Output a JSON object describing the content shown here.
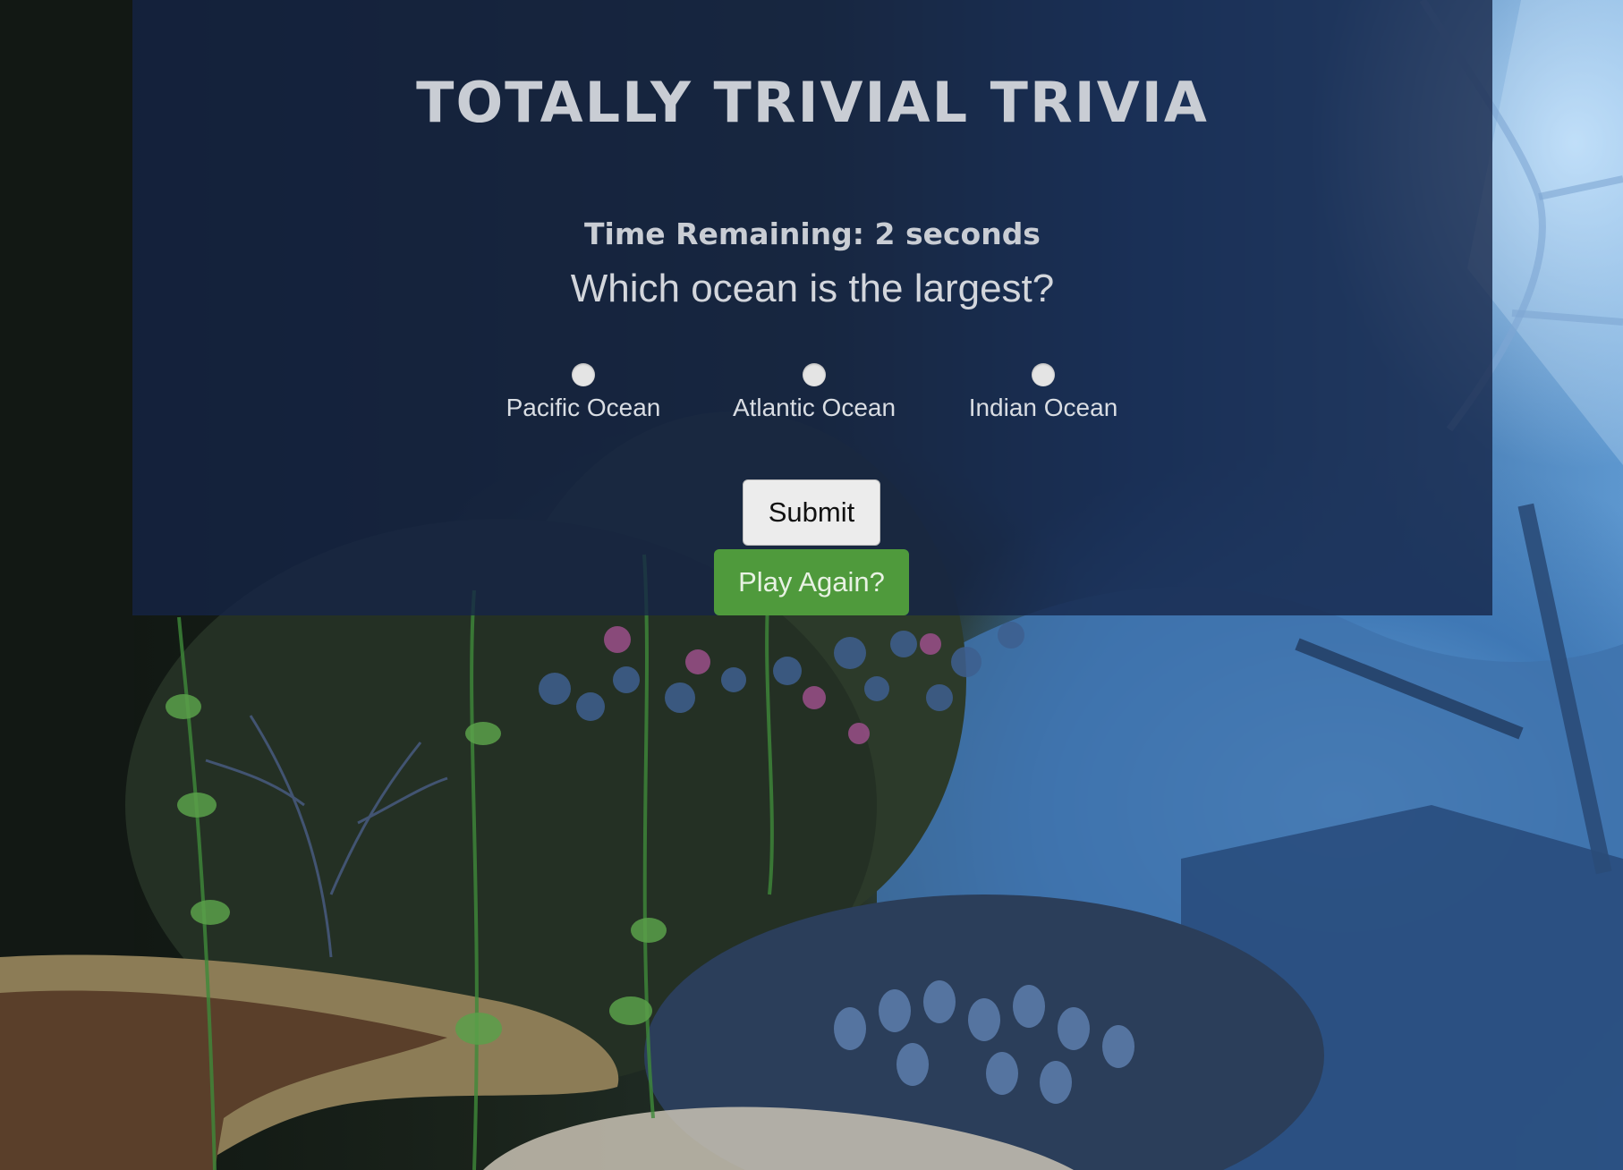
{
  "app": {
    "title": "TOTALLY TRIVIAL TRIVIA"
  },
  "timer": {
    "text": "Time Remaining: 2 seconds",
    "seconds_remaining": 2
  },
  "question": {
    "text": "Which ocean is the largest?",
    "answers": [
      {
        "label": "Pacific Ocean",
        "selected": false
      },
      {
        "label": "Atlantic Ocean",
        "selected": false
      },
      {
        "label": "Indian Ocean",
        "selected": false
      }
    ]
  },
  "buttons": {
    "submit_label": "Submit",
    "play_again_label": "Play Again?"
  },
  "colors": {
    "panel": "#142446",
    "play_again": "#4f9a3c",
    "submit": "#ececec",
    "text": "#c9cdd4"
  },
  "background": {
    "description_icon": "underwater-reef-scene"
  }
}
